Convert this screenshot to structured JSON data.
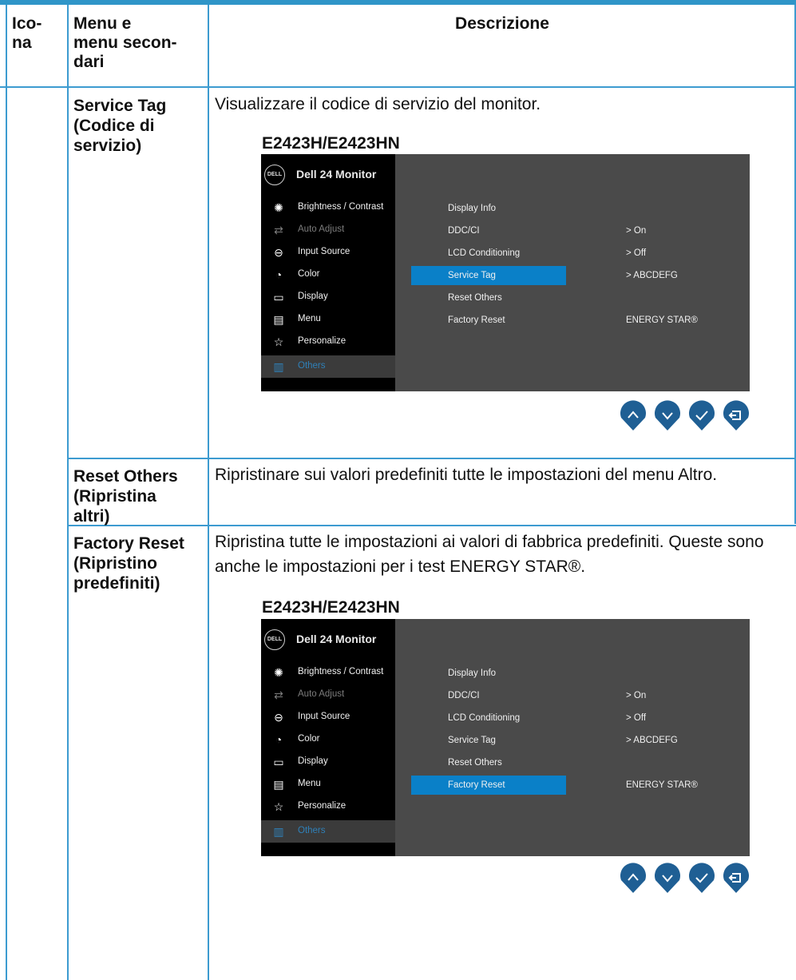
{
  "header": {
    "icon_col": "Ico-\nna",
    "menu_col": "Menu e\nmenu secon-\ndari",
    "desc_col": "Descrizione"
  },
  "rows": [
    {
      "menu": "Service Tag\n(Codice di\nservizio)",
      "description": "Visualizzare il codice di servizio del monitor.",
      "model": "E2423H/E2423HN"
    },
    {
      "menu": "Reset Others\n(Ripristina\naltri)",
      "description": "Ripristinare sui valori predefiniti tutte le impostazioni del menu Altro."
    },
    {
      "menu": "Factory Reset\n(Ripristino\npredefiniti)",
      "description": "Ripristina tutte le impostazioni ai valori di fabbrica predefiniti. Queste sono anche le impostazioni per i test ENERGY STAR®.",
      "model": "E2423H/E2423HN"
    }
  ],
  "osd": {
    "logo": "DELL",
    "title": "Dell 24 Monitor",
    "menu_items": [
      {
        "label": "Brightness / Contrast",
        "icon": "brightness-icon"
      },
      {
        "label": "Auto Adjust",
        "icon": "auto-adjust-icon"
      },
      {
        "label": "Input Source",
        "icon": "input-source-icon"
      },
      {
        "label": "Color",
        "icon": "color-icon"
      },
      {
        "label": "Display",
        "icon": "display-icon"
      },
      {
        "label": "Menu",
        "icon": "menu-icon"
      },
      {
        "label": "Personalize",
        "icon": "star-icon"
      },
      {
        "label": "Others",
        "icon": "others-icon"
      }
    ],
    "sub_items": [
      "Display Info",
      "DDC/CI",
      "LCD Conditioning",
      "Service Tag",
      "Reset Others",
      "Factory Reset"
    ],
    "values": {
      "ddc_ci": ">  On",
      "lcd_conditioning": ">  Off",
      "service_tag": ">  ABCDEFG",
      "energy_star": "ENERGY STAR®"
    },
    "buttons": [
      "up-button",
      "down-button",
      "ok-button",
      "back-button"
    ]
  },
  "colors": {
    "border": "#3d9bd0",
    "highlight": "#0a80c8",
    "osd_bg": "#4a4a4a",
    "osd_side": "#000000"
  }
}
